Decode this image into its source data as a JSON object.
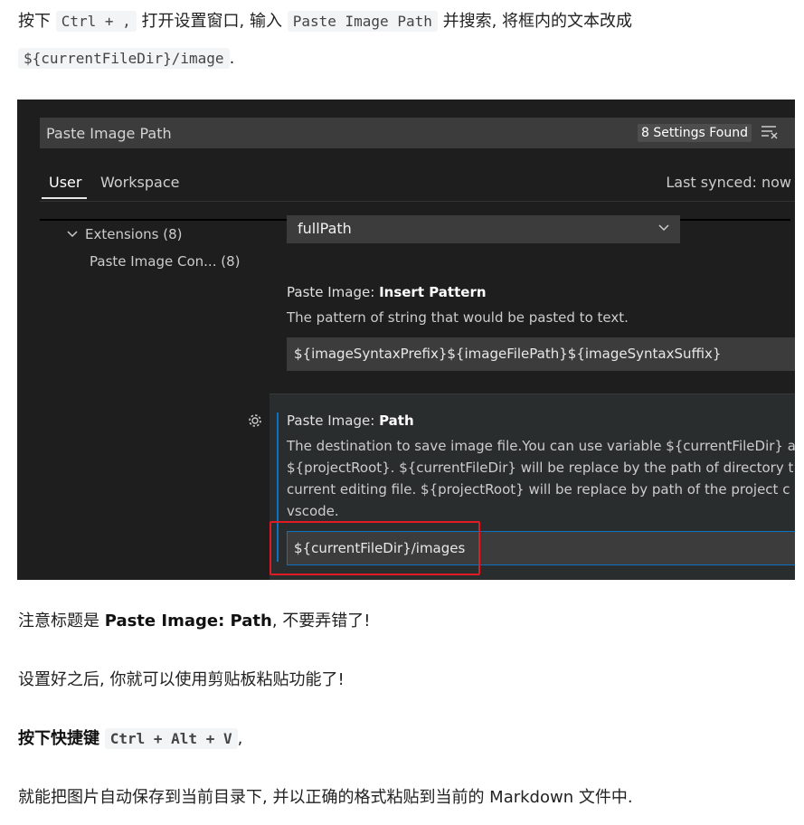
{
  "intro": {
    "prefix": "按下",
    "shortcut1": "Ctrl + ,",
    "mid": "打开设置窗口, 输入",
    "search_term": "Paste Image Path",
    "suffix": "并搜索, 将框内的文本改成",
    "target_value": "${currentFileDir}/image",
    "end": "."
  },
  "vscode": {
    "search": {
      "value": "Paste Image Path",
      "results_badge": "8 Settings Found",
      "filter_icon": "clear-filter-icon"
    },
    "tabs": [
      {
        "label": "User"
      },
      {
        "label": "Workspace"
      }
    ],
    "sync_status": "Last synced: now",
    "tree": {
      "group_label": "Extensions (8)",
      "item_label": "Paste Image Con... (8)"
    },
    "dropdown_value": "fullPath",
    "insert_pattern": {
      "title_prefix": "Paste Image: ",
      "title_bold": "Insert Pattern",
      "description": "The pattern of string that would be pasted to text.",
      "value": "${imageSyntaxPrefix}${imageFilePath}${imageSyntaxSuffix}"
    },
    "path_setting": {
      "title_prefix": "Paste Image: ",
      "title_bold": "Path",
      "description_lines": [
        "The destination to save image file.You can use variable ${currentFileDir} a",
        "${projectRoot}. ${currentFileDir} will be replace by the path of directory t",
        "current editing file. ${projectRoot} will be replace by path of the project c",
        "vscode."
      ],
      "value": "${currentFileDir}/images"
    },
    "colors": {
      "background": "#1e1e1e",
      "input": "#3c3c3c",
      "focus": "#0e70c0",
      "highlight_box": "#e01b24"
    }
  },
  "note": {
    "prefix": "注意标题是",
    "bold": "Paste Image: Path",
    "suffix": ", 不要弄错了!"
  },
  "after_setup": "设置好之后, 你就可以使用剪贴板粘贴功能了!",
  "shortcut_line": {
    "bold": "按下快捷键",
    "shortcut": "Ctrl + Alt + V",
    "suffix": ","
  },
  "final": "就能把图片自动保存到当前目录下, 并以正确的格式粘贴到当前的 Markdown 文件中."
}
